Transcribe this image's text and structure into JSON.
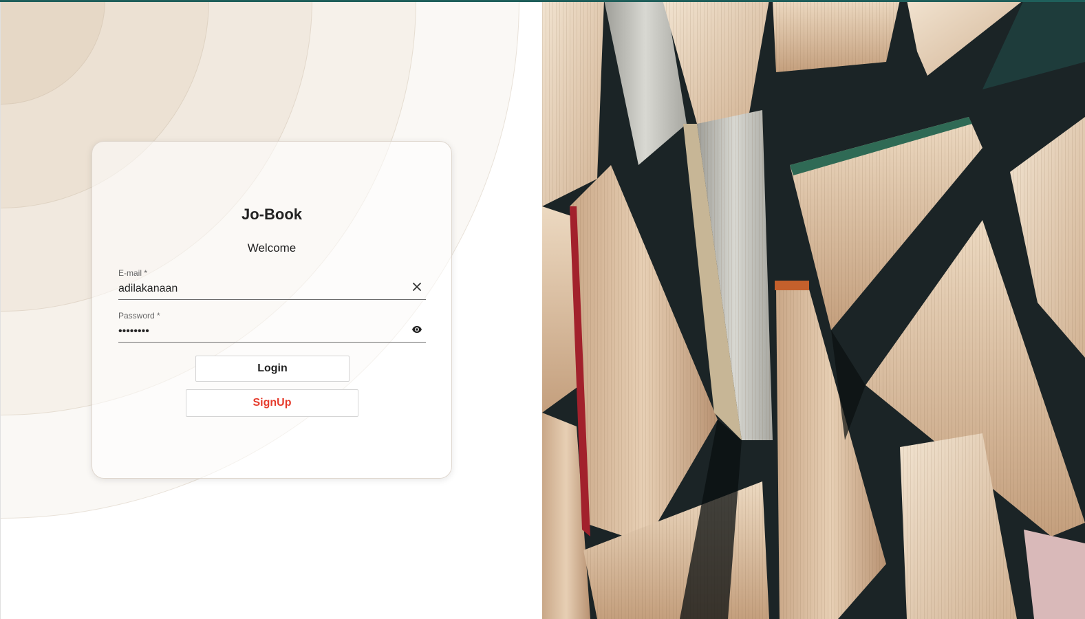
{
  "app": {
    "title": "Jo-Book",
    "welcome": "Welcome"
  },
  "form": {
    "email": {
      "label": "E-mail *",
      "value": "adilakanaan",
      "clear_icon": "close-icon"
    },
    "password": {
      "label": "Password *",
      "value": "••••••••",
      "visibility_icon": "eye-icon"
    },
    "login_label": "Login",
    "signup_label": "SignUp"
  },
  "colors": {
    "accent_bar": "#1f5f5b",
    "signup_text": "#e53b2c",
    "title_text": "#222222"
  },
  "hero_image": {
    "icon": "books-photo"
  }
}
